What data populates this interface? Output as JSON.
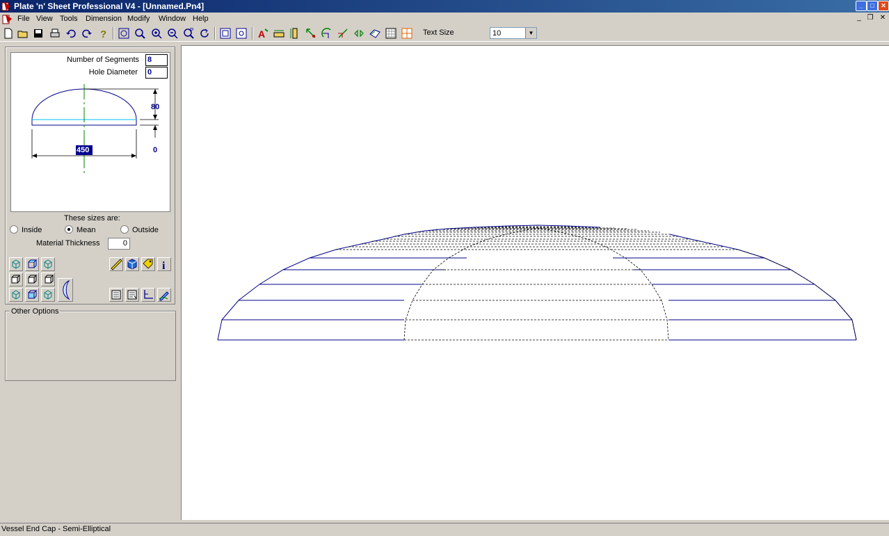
{
  "window": {
    "title": "Plate 'n' Sheet Professional V4 - [Unnamed.Pn4]"
  },
  "menu": {
    "items": [
      "File",
      "View",
      "Tools",
      "Dimension",
      "Modify",
      "Window",
      "Help"
    ]
  },
  "toolbar": {
    "text_size_label": "Text Size",
    "text_size_value": "10",
    "icons": [
      "new-icon",
      "open-icon",
      "save-icon",
      "print-icon",
      "undo-icon",
      "redo-icon",
      "help-icon",
      "zoom-extents-icon",
      "zoom-window-icon",
      "zoom-in-icon",
      "zoom-out-icon",
      "zoom-previous-icon",
      "redraw-icon",
      "fit-page-icon",
      "fit-window-icon",
      "text-color-icon",
      "dimension-icon",
      "vertical-dim-icon",
      "move-icon",
      "rotate-icon",
      "scale-icon",
      "mirror-icon",
      "offset-icon",
      "grid-icon",
      "layout-grid-icon"
    ]
  },
  "params": {
    "segments_label": "Number of Segments",
    "segments_value": "8",
    "hole_label": "Hole Diameter",
    "hole_value": "0",
    "dim_height": "80",
    "dim_straight": "0",
    "dim_diameter": "450",
    "sizes_label": "These sizes are:",
    "radio_inside": "Inside",
    "radio_mean": "Mean",
    "radio_outside": "Outside",
    "selected_size": "Mean",
    "thickness_label": "Material Thickness",
    "thickness_value": "0"
  },
  "other_options": {
    "legend": "Other Options"
  },
  "status": {
    "text": "Vessel End Cap - Semi-Elliptical"
  },
  "colors": {
    "title_start": "#0a246a",
    "title_end": "#3a6ea5",
    "face": "#d4d0c8",
    "drawing_line": "#00008b",
    "centerline": "#008000",
    "tangent_line": "#00bfff"
  }
}
